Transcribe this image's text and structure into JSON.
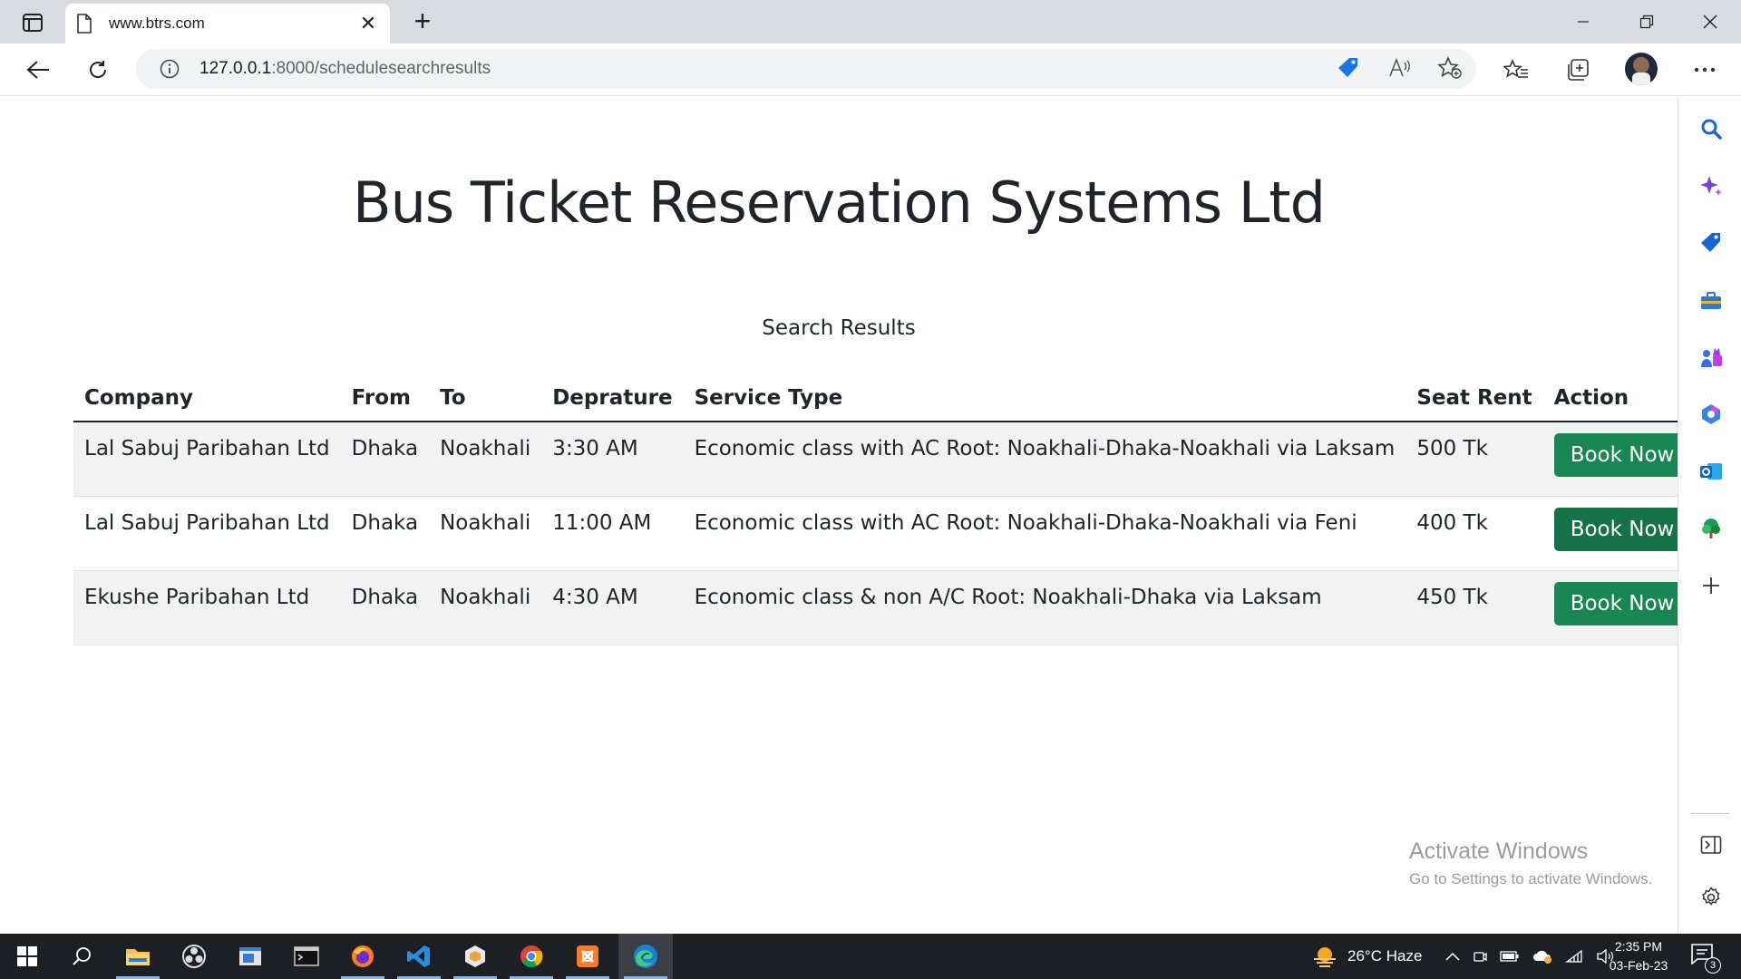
{
  "browser": {
    "tab_title": "www.btrs.com",
    "new_tab_symbol": "+",
    "close_symbol": "✕",
    "url_host": "127.0.0.1",
    "url_path": ":8000/schedulesearchresults"
  },
  "page": {
    "title": "Bus Ticket Reservation Systems Ltd",
    "section_title": "Search Results",
    "table": {
      "headers": [
        "Company",
        "From",
        "To",
        "Depraturе",
        "Service Type",
        "Seat Rent",
        "Action"
      ],
      "rows": [
        {
          "company": "Lal Sabuj Paribahan Ltd",
          "from": "Dhaka",
          "to": "Noakhali",
          "departure": "3:30 AM",
          "service_type": "Economic class with AC Root: Noakhali-Dhaka-Noakhali via Laksam",
          "seat_rent": "500 Tk",
          "action_label": "Book Now"
        },
        {
          "company": "Lal Sabuj Paribahan Ltd",
          "from": "Dhaka",
          "to": "Noakhali",
          "departure": "11:00 AM",
          "service_type": "Economic class with AC Root: Noakhali-Dhaka-Noakhali via Feni",
          "seat_rent": "400 Tk",
          "action_label": "Book Now"
        },
        {
          "company": "Ekushe Paribahan Ltd",
          "from": "Dhaka",
          "to": "Noakhali",
          "departure": "4:30 AM",
          "service_type": "Economic class & non A/C Root: Noakhali-Dhaka via Laksam",
          "seat_rent": "450 Tk",
          "action_label": "Book Now"
        }
      ]
    }
  },
  "watermark": {
    "title": "Activate Windows",
    "subtitle": "Go to Settings to activate Windows."
  },
  "taskbar": {
    "weather": "26°C  Haze",
    "time": "2:35 PM",
    "date": "03-Feb-23",
    "notification_count": "3"
  },
  "colors": {
    "button_primary": "#198754",
    "button_hover": "#157347",
    "row_stripe": "#f2f2f2",
    "taskbar_bg": "#1c1f24"
  }
}
